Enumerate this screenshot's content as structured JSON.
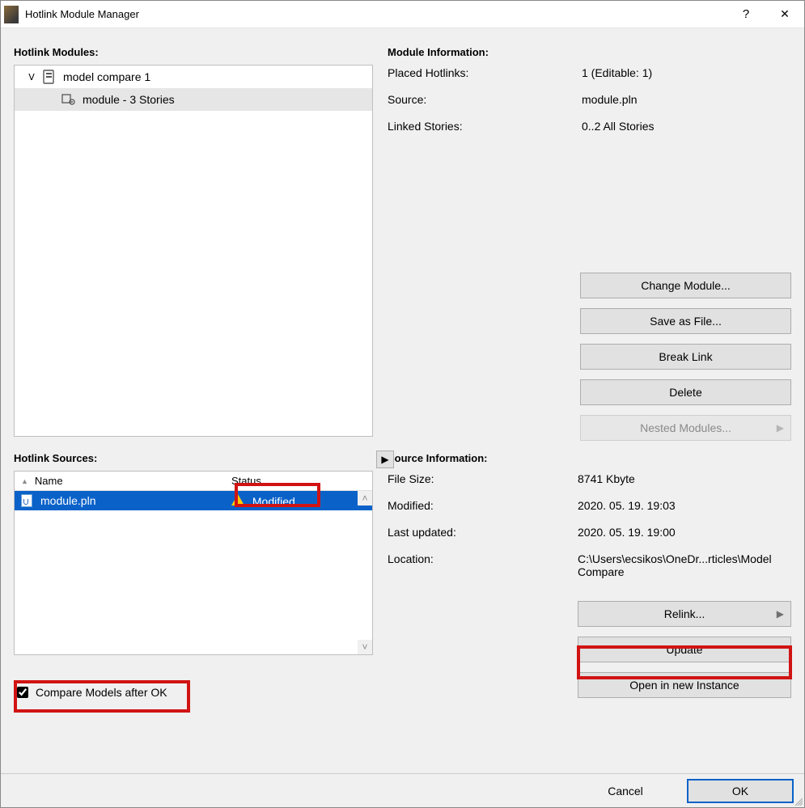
{
  "window": {
    "title": "Hotlink Module Manager"
  },
  "modules": {
    "heading": "Hotlink Modules:",
    "root": {
      "label": "model compare 1"
    },
    "child": {
      "label": "module - 3 Stories"
    }
  },
  "module_info": {
    "heading": "Module Information:",
    "placed_hotlinks": {
      "key": "Placed Hotlinks:",
      "value": "1 (Editable: 1)"
    },
    "source": {
      "key": "Source:",
      "value": "module.pln"
    },
    "linked_stories": {
      "key": "Linked Stories:",
      "value": "0..2 All Stories"
    },
    "buttons": {
      "change_module": "Change Module...",
      "save_as_file": "Save as File...",
      "break_link": "Break Link",
      "delete": "Delete",
      "nested_modules": "Nested Modules..."
    }
  },
  "sources": {
    "heading": "Hotlink Sources:",
    "columns": {
      "name": "Name",
      "status": "Status"
    },
    "row": {
      "name": "module.pln",
      "status": "Modified"
    },
    "compare_checkbox": "Compare Models after OK"
  },
  "source_info": {
    "heading": "Source Information:",
    "file_size": {
      "key": "File Size:",
      "value": "8741 Kbyte"
    },
    "modified": {
      "key": "Modified:",
      "value": "2020. 05. 19. 19:03"
    },
    "last_updated": {
      "key": "Last updated:",
      "value": "2020. 05. 19. 19:00"
    },
    "location": {
      "key": "Location:",
      "value": "C:\\Users\\ecsikos\\OneDr...rticles\\Model Compare"
    },
    "buttons": {
      "relink": "Relink...",
      "update": "Update",
      "open_in_new_instance": "Open in new Instance"
    }
  },
  "footer": {
    "cancel": "Cancel",
    "ok": "OK"
  }
}
